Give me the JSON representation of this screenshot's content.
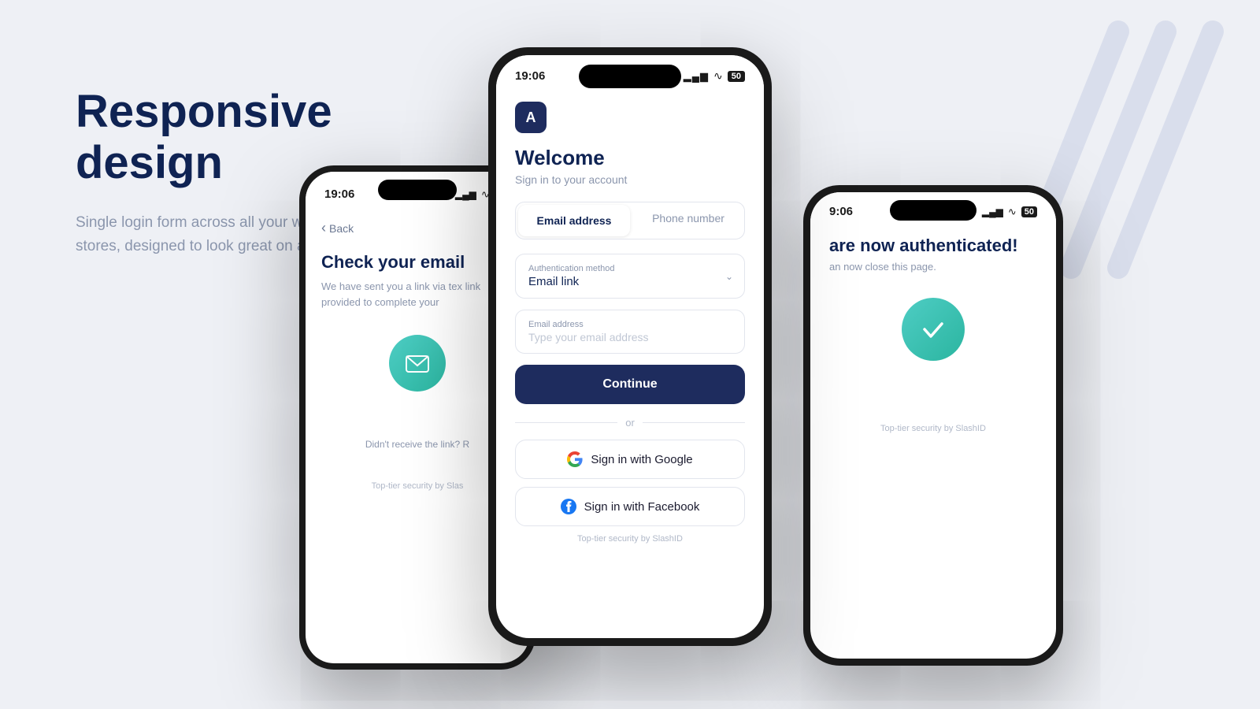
{
  "background": {
    "color": "#eef0f5"
  },
  "left": {
    "headline": "Responsive design",
    "subtext": "Single login form across all your websites and Shopify stores, designed to look great on all screen sizes."
  },
  "phone_main": {
    "status_time": "19:06",
    "logo_letter": "A",
    "welcome_title": "Welcome",
    "welcome_sub": "Sign in to your account",
    "tab_email": "Email address",
    "tab_phone": "Phone number",
    "auth_method_label": "Authentication method",
    "auth_method_value": "Email link",
    "email_field_label": "Email address",
    "email_placeholder": "Type your email address",
    "continue_btn": "Continue",
    "divider_or": "or",
    "google_btn": "Sign in with Google",
    "facebook_btn": "Sign in with Facebook",
    "security": "Top-tier security by SlashID"
  },
  "phone_left": {
    "status_time": "19:06",
    "back_label": "Back",
    "title": "Check your email",
    "subtitle": "We have sent you a link via tex link provided to complete your",
    "resend": "Didn't receive the link? R",
    "security": "Top-tier security by Slas"
  },
  "phone_right": {
    "status_time": "9:06",
    "title": "are now authenticated!",
    "subtitle": "an now close this page.",
    "security": "Top-tier security by SlashID"
  },
  "icons": {
    "google_g": "G",
    "facebook_f": "f",
    "check_mark": "✓",
    "envelope": "✉",
    "chevron_down": "∨",
    "back_arrow": "‹",
    "signal_bars": "▂▄▆",
    "wifi": "wifi",
    "battery": "50"
  }
}
